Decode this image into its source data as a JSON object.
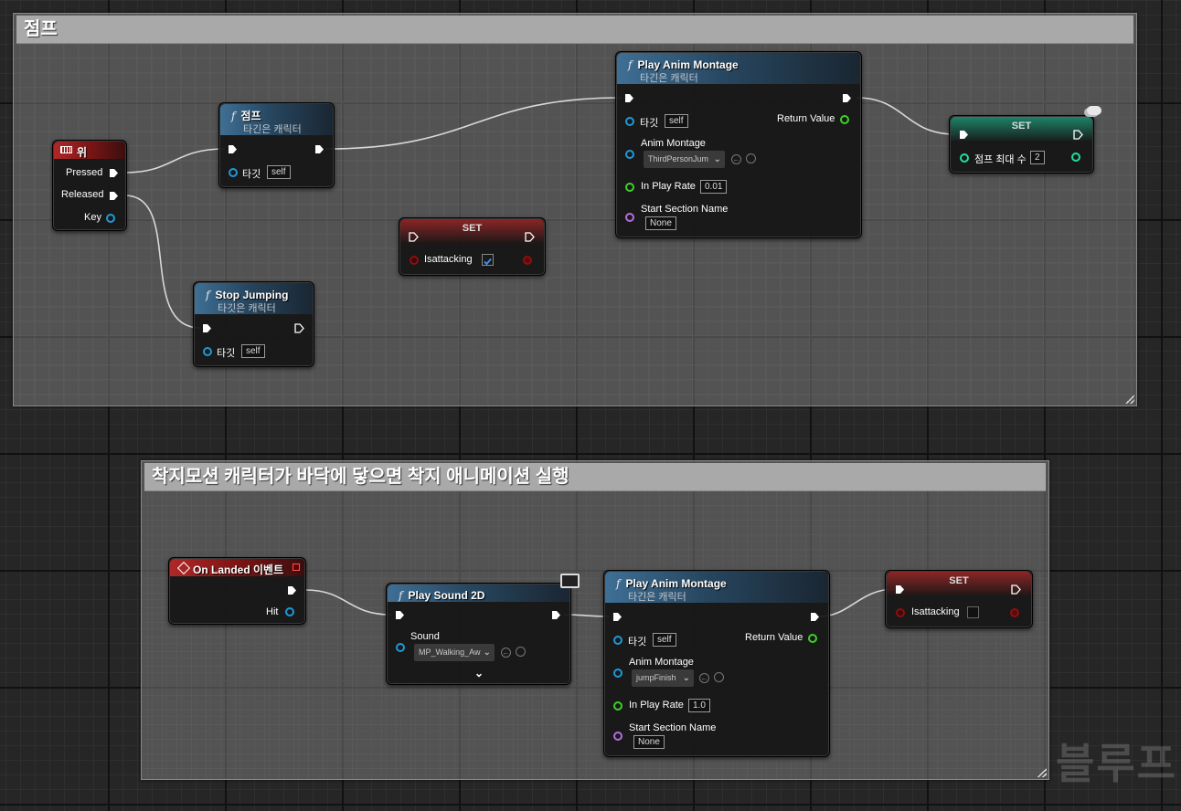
{
  "comments": {
    "jump": {
      "title": "점프"
    },
    "landing": {
      "title": "착지모션 캐릭터가 바닥에 닿으면 착지 애니메이션 실행"
    }
  },
  "pins": {
    "target": "타깃",
    "self": "self",
    "return_value": "Return Value",
    "anim_montage": "Anim Montage",
    "in_play_rate": "In Play Rate",
    "start_section_name": "Start Section Name",
    "none": "None",
    "target_is_character": "타깃은 캐릭터",
    "target_is_character_alt": "타긴은 캐릭터"
  },
  "nodes": {
    "up_event": {
      "title": "위",
      "pressed": "Pressed",
      "released": "Released",
      "key": "Key"
    },
    "jump_fn": {
      "title": "점프"
    },
    "stop_jumping": {
      "title": "Stop Jumping"
    },
    "set_isattacking_1": {
      "title": "SET",
      "var": "Isattacking",
      "checked": true
    },
    "play_montage_1": {
      "title": "Play Anim Montage",
      "montage": "ThirdPersonJum",
      "rate": "0.01"
    },
    "set_jump_max": {
      "title": "SET",
      "var": "점프 최대 수",
      "value": "2"
    },
    "on_landed": {
      "title": "On Landed 이벤트",
      "hit": "Hit"
    },
    "play_sound": {
      "title": "Play Sound 2D",
      "sound_label": "Sound",
      "sound": "MP_Walking_Aw"
    },
    "play_montage_2": {
      "title": "Play Anim Montage",
      "montage": "jumpFinish",
      "rate": "1.0"
    },
    "set_isattacking_2": {
      "title": "SET",
      "var": "Isattacking",
      "checked": false
    }
  },
  "watermark": "블루프",
  "colors": {
    "exec": "#ffffff",
    "object_pin": "#1c9ad9",
    "float_pin": "#3ed128",
    "name_pin": "#b46ee0",
    "bool_pin": "#8c1010",
    "int_pin": "#1fdfa4"
  }
}
